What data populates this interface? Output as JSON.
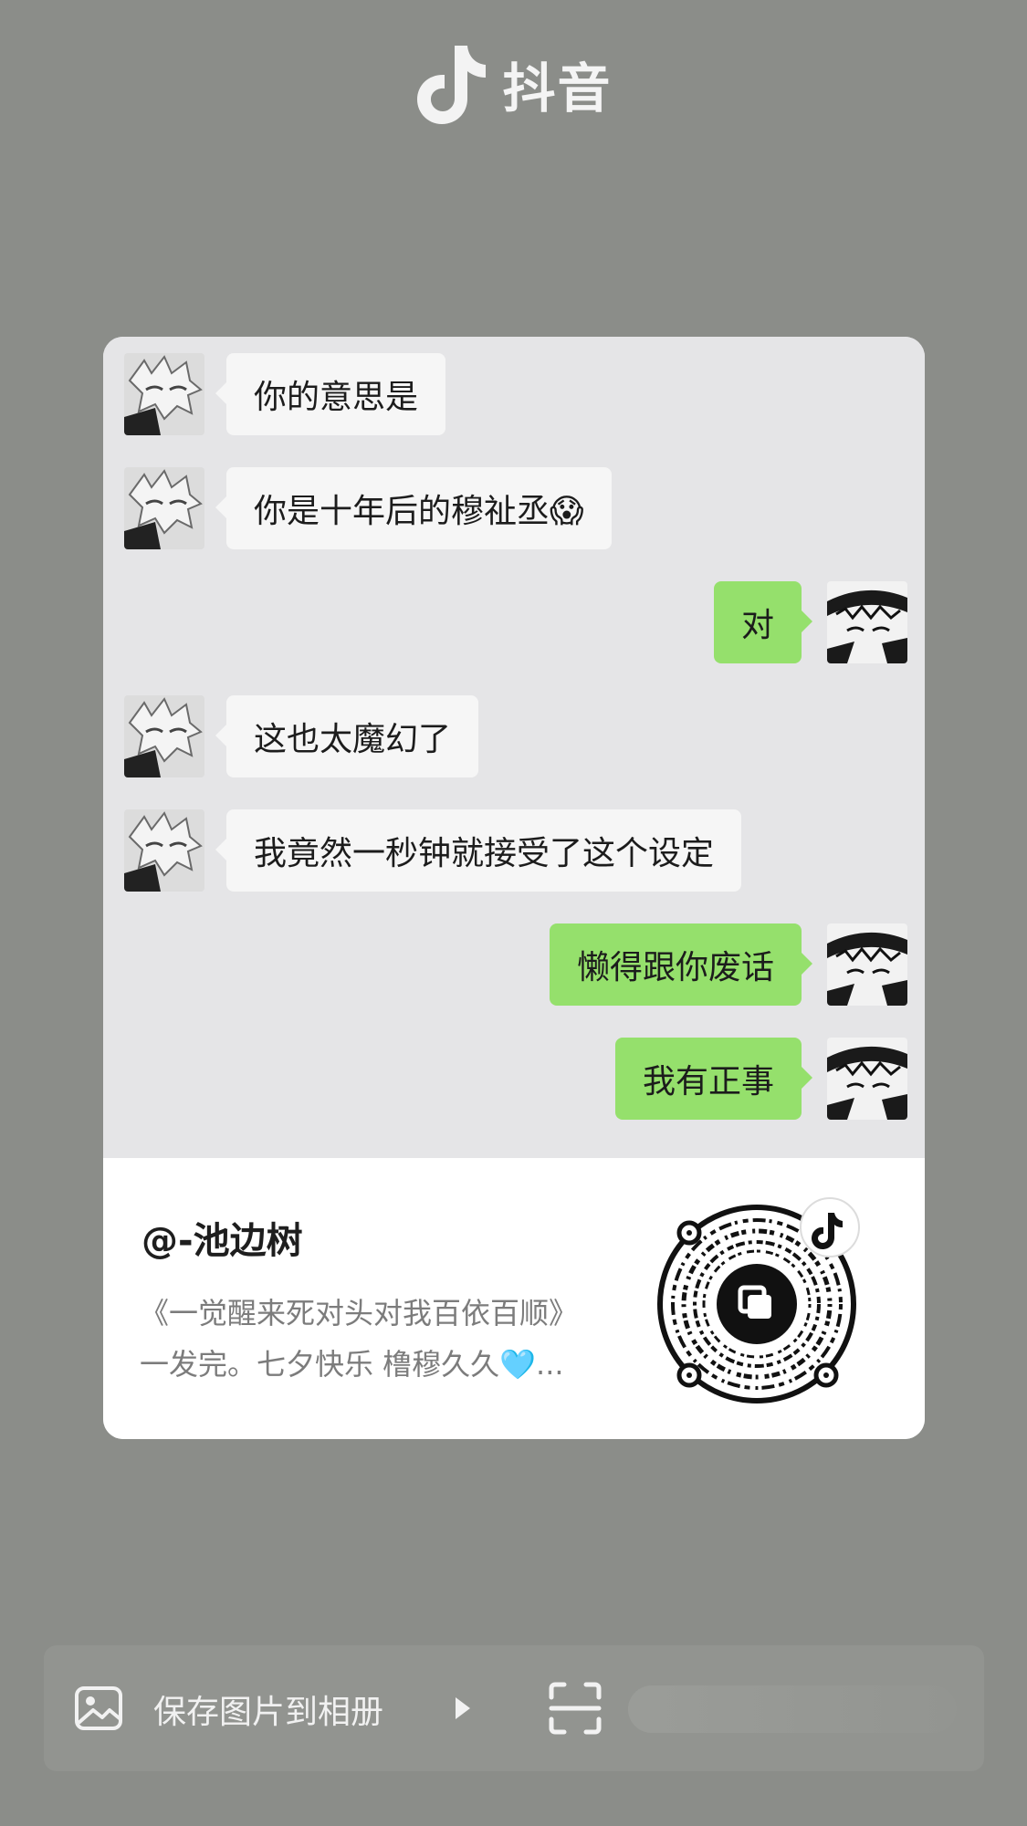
{
  "brand": {
    "name": "抖音",
    "icon": "douyin-note-icon"
  },
  "messages": [
    {
      "side": "in",
      "text": "你的意思是"
    },
    {
      "side": "in",
      "text": "你是十年后的穆祉丞😱"
    },
    {
      "side": "out",
      "text": "对"
    },
    {
      "side": "in",
      "text": "这也太魔幻了"
    },
    {
      "side": "in",
      "text": "我竟然一秒钟就接受了这个设定"
    },
    {
      "side": "out",
      "text": "懒得跟你废话"
    },
    {
      "side": "out",
      "text": "我有正事"
    }
  ],
  "footer": {
    "author": "@-池边树",
    "description_line1": "《一觉醒来死对头对我百依百顺》",
    "description_line2": "一发完。七夕快乐 橹穆久久🩵..."
  },
  "actions": {
    "save_label": "保存图片到相册",
    "gallery_icon": "image-icon",
    "scan_icon": "scan-icon"
  },
  "colors": {
    "background": "#8b8d89",
    "chat_background": "#e5e5e7",
    "incoming_bubble": "#f6f6f6",
    "outgoing_bubble": "#95e06c"
  }
}
